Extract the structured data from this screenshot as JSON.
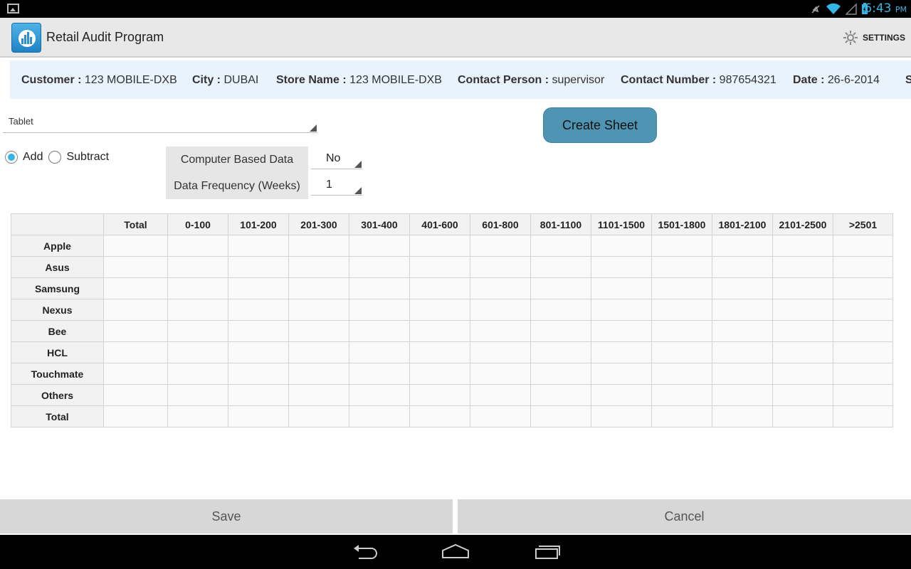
{
  "status_bar": {
    "time": "6:43",
    "ampm": "PM"
  },
  "app": {
    "title": "Retail Audit Program",
    "settings_label": "SETTINGS"
  },
  "info": [
    {
      "label": "Customer : ",
      "value": "123 MOBILE-DXB"
    },
    {
      "label": "City : ",
      "value": "DUBAI"
    },
    {
      "label": "Store Name : ",
      "value": "123 MOBILE-DXB"
    },
    {
      "label": "Contact Person : ",
      "value": "supervisor"
    },
    {
      "label": "Contact Number : ",
      "value": "987654321"
    },
    {
      "label": "Date : ",
      "value": "26-6-2014"
    },
    {
      "label": "S",
      "value": ""
    }
  ],
  "category_select": {
    "value": "Tablet"
  },
  "create_button": "Create Sheet",
  "mode": {
    "options": [
      "Add",
      "Subtract"
    ],
    "selected": "Add"
  },
  "options": {
    "computer_based": {
      "label": "Computer Based Data",
      "value": "No"
    },
    "frequency": {
      "label": "Data Frequency (Weeks)",
      "value": "1"
    }
  },
  "table": {
    "columns": [
      "Total",
      "0-100",
      "101-200",
      "201-300",
      "301-400",
      "401-600",
      "601-800",
      "801-1100",
      "1101-1500",
      "1501-1800",
      "1801-2100",
      "2101-2500",
      ">2501"
    ],
    "rows": [
      "Apple",
      "Asus",
      "Samsung",
      "Nexus",
      "Bee",
      "HCL",
      "Touchmate",
      "Others",
      "Total"
    ]
  },
  "buttons": {
    "save": "Save",
    "cancel": "Cancel"
  },
  "colors": {
    "accent": "#33b5e5",
    "button": "#4f95b3",
    "info_bg": "#e9f3fb"
  }
}
